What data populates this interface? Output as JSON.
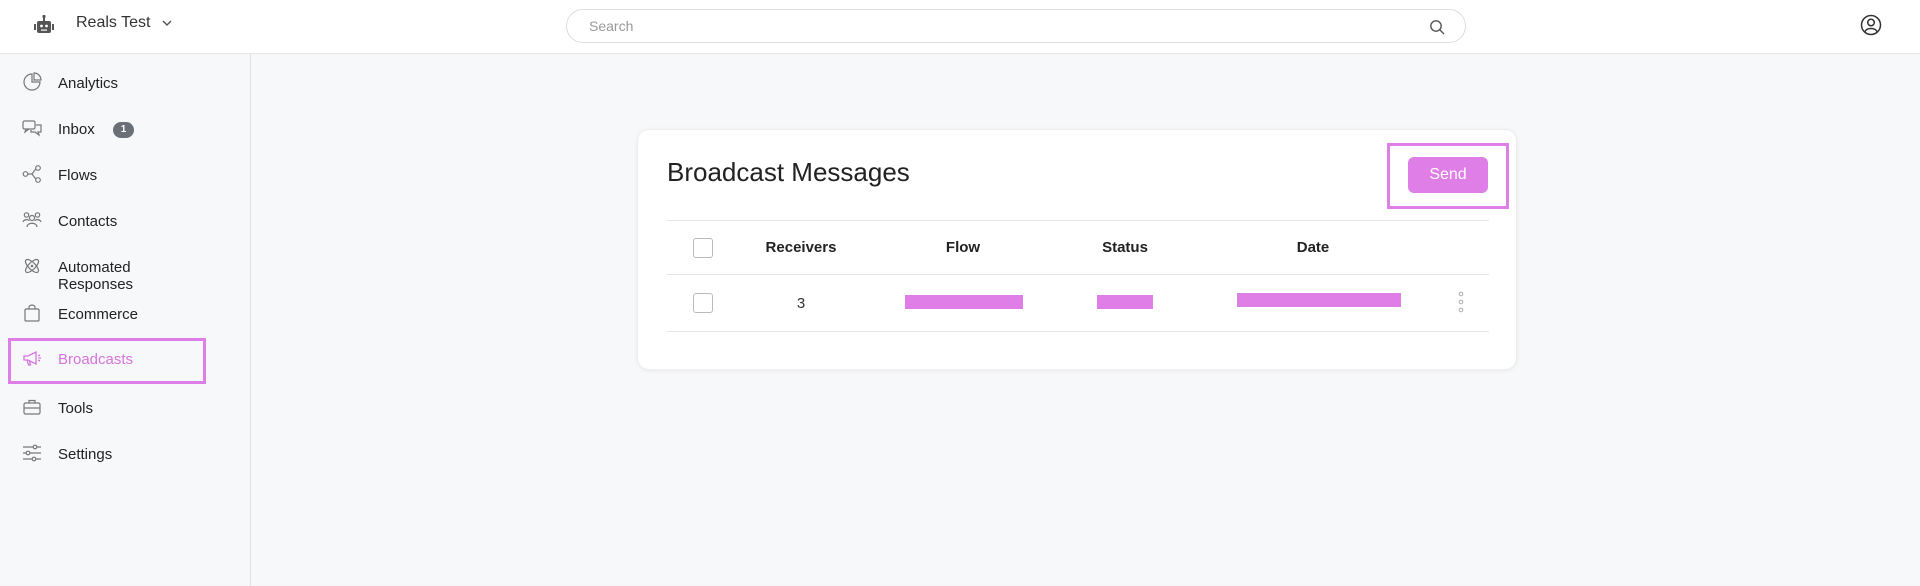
{
  "topbar": {
    "workspace_name": "Reals Test",
    "search_placeholder": "Search"
  },
  "sidebar": {
    "items": [
      {
        "label": "Analytics",
        "icon": "pie-chart-icon"
      },
      {
        "label": "Inbox",
        "icon": "chat-bubbles-icon",
        "badge": "1"
      },
      {
        "label": "Flows",
        "icon": "flow-nodes-icon"
      },
      {
        "label": "Contacts",
        "icon": "people-icon"
      },
      {
        "label": "Automated Responses",
        "icon": "atom-icon"
      },
      {
        "label": "Ecommerce",
        "icon": "shopping-bag-icon"
      },
      {
        "label": "Broadcasts",
        "icon": "megaphone-icon",
        "active": true
      },
      {
        "label": "Tools",
        "icon": "toolbox-icon"
      },
      {
        "label": "Settings",
        "icon": "sliders-icon"
      }
    ]
  },
  "main": {
    "title": "Broadcast Messages",
    "send_label": "Send",
    "table": {
      "headers": [
        "Receivers",
        "Flow",
        "Status",
        "Date"
      ],
      "rows": [
        {
          "receivers": "3"
        }
      ]
    }
  },
  "colors": {
    "accent": "#e07ee8",
    "accent_text": "#d575dc",
    "badge": "#6b6f78"
  }
}
